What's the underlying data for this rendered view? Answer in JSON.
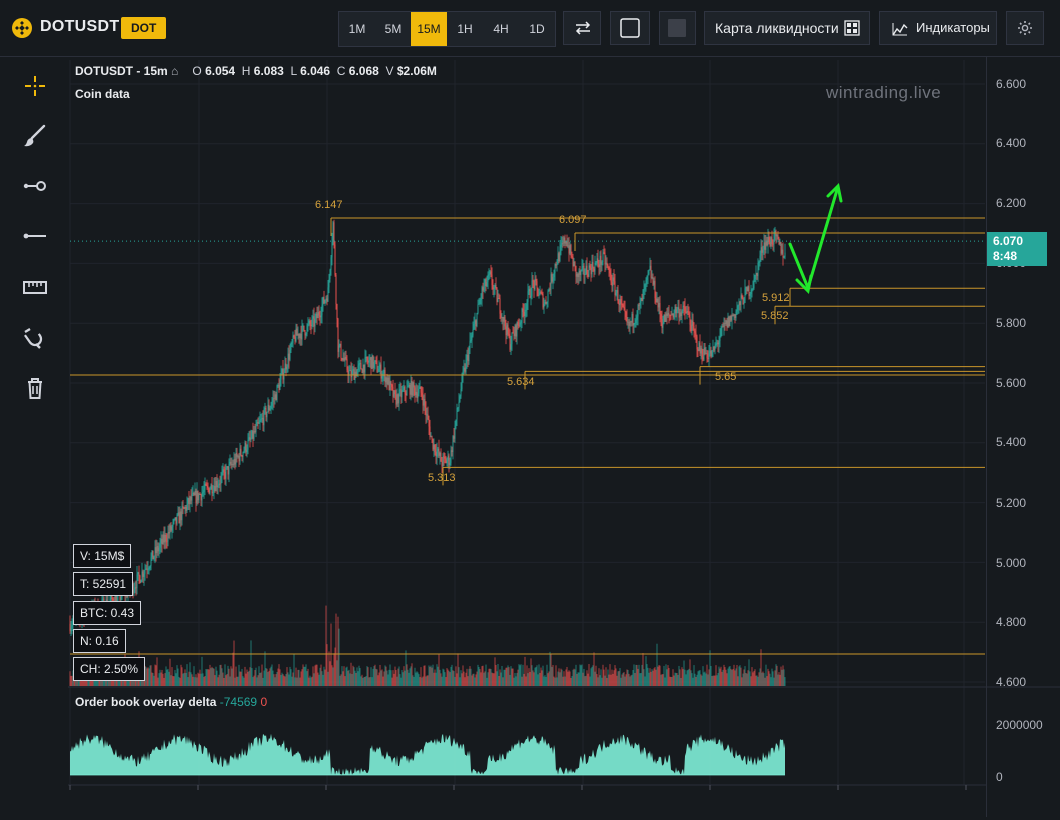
{
  "header": {
    "symbol": "DOTUSDT",
    "badge": "DOT",
    "timeframes": [
      "1M",
      "5M",
      "15M",
      "1H",
      "4H",
      "1D"
    ],
    "active_timeframe": "15M",
    "liquidity_label": "Карта ликвидности",
    "indicators_label": "Индикаторы"
  },
  "legend": {
    "title": "DOTUSDT - 15m",
    "o_label": "O",
    "o": "6.054",
    "h_label": "H",
    "h": "6.083",
    "l_label": "L",
    "l": "6.046",
    "c_label": "C",
    "c": "6.068",
    "v_label": "V",
    "v": "$2.06M",
    "coin_data": "Coin data"
  },
  "watermark": "wintrading.live",
  "stats": [
    "V: 15M$",
    "T: 52591",
    "BTC: 0.43",
    "N: 0.16",
    "CH: 2.50%"
  ],
  "order_book": {
    "title": "Order book overlay delta",
    "pos": "-74569",
    "neg": "0"
  },
  "price_axis": [
    "6.600",
    "6.400",
    "6.200",
    "6.000",
    "5.800",
    "5.600",
    "5.400",
    "5.200",
    "5.000",
    "4.800",
    "4.600"
  ],
  "delta_axis": [
    "2000000",
    "0"
  ],
  "current_price": {
    "price": "6.070",
    "timer": "8:48"
  },
  "levels": [
    {
      "label": "6.147",
      "price": 6.147
    },
    {
      "label": "6.097",
      "price": 6.097
    },
    {
      "label": "5.912",
      "price": 5.912
    },
    {
      "label": "5.852",
      "price": 5.852
    },
    {
      "label": "5.634",
      "price": 5.634
    },
    {
      "label": "5.65",
      "price": 5.65
    },
    {
      "label": "5.313",
      "price": 5.313
    }
  ],
  "colors": {
    "up": "#26a69a",
    "down": "#ef5350",
    "accent": "#f0b90b",
    "level": "#c9952a",
    "arrow": "#22e82c",
    "delta": "#7ff0d8"
  },
  "icons": [
    "crosshair-icon",
    "brush-icon",
    "ray-icon",
    "hline-icon",
    "ruler-icon",
    "magnet-icon",
    "trash-icon",
    "swap-icon",
    "square-outline-icon",
    "square-filled-icon",
    "heatmap-icon",
    "indicators-icon",
    "gear-icon"
  ]
}
